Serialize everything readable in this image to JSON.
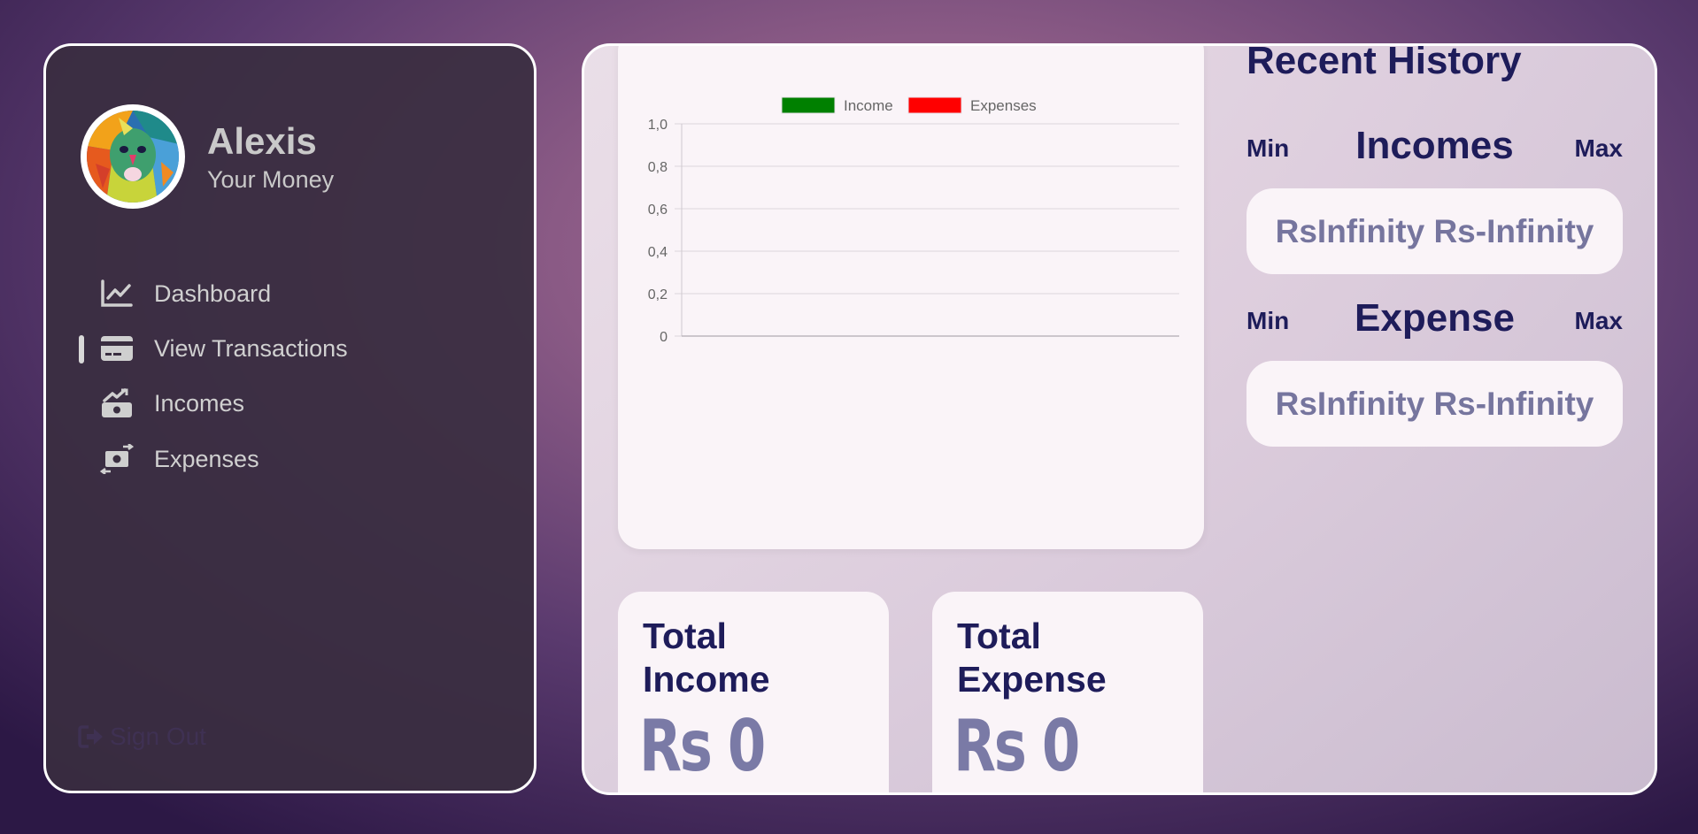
{
  "user": {
    "name": "Alexis",
    "subtitle": "Your Money"
  },
  "nav": [
    {
      "label": "Dashboard",
      "icon": "chart-line-icon",
      "active": false
    },
    {
      "label": "View Transactions",
      "icon": "credit-card-icon",
      "active": true
    },
    {
      "label": "Incomes",
      "icon": "money-trend-up-icon",
      "active": false
    },
    {
      "label": "Expenses",
      "icon": "money-exchange-icon",
      "active": false
    }
  ],
  "signout": {
    "label": "Sign Out",
    "icon": "sign-out-icon"
  },
  "chart_data": {
    "type": "line",
    "title": "",
    "xlabel": "",
    "ylabel": "",
    "ylim": [
      0,
      1
    ],
    "yticks": [
      "1,0",
      "0,8",
      "0,6",
      "0,4",
      "0,2",
      "0"
    ],
    "x": [],
    "series": [
      {
        "name": "Income",
        "color": "#008000",
        "values": []
      },
      {
        "name": "Expenses",
        "color": "#ff0000",
        "values": []
      }
    ],
    "grid": true,
    "legend": "top"
  },
  "totals": {
    "income": {
      "title_line1": "Total",
      "title_line2": "Income",
      "value": "Rs 0"
    },
    "expense": {
      "title_line1": "Total",
      "title_line2": "Expense",
      "value": "Rs 0"
    }
  },
  "history": {
    "title": "Recent History",
    "incomes": {
      "min_label": "Min",
      "title": "Incomes",
      "max_label": "Max",
      "value": "RsInfinity Rs-Infinity"
    },
    "expense": {
      "min_label": "Min",
      "title": "Expense",
      "max_label": "Max",
      "value": "RsInfinity Rs-Infinity"
    }
  },
  "colors": {
    "accent": "#1e1c5a",
    "muted_value": "#7a7aa6",
    "sidebar_bg": "#3a2e40",
    "card_bg": "#faf4f8"
  }
}
